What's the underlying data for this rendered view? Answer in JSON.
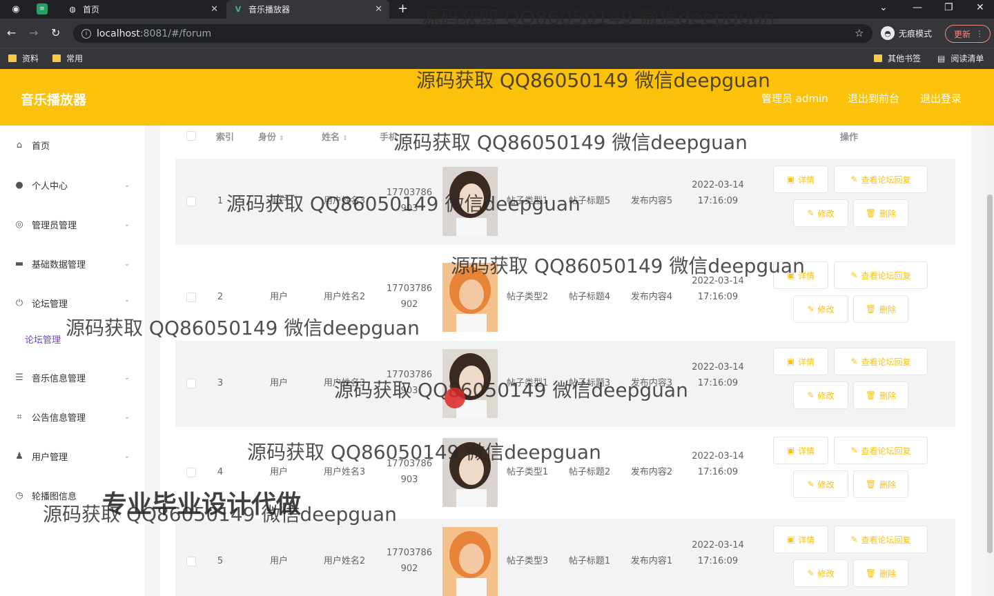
{
  "browser": {
    "tabs": [
      {
        "label": "首页"
      },
      {
        "label": "音乐播放器"
      }
    ],
    "url_host": "localhost",
    "url_path": ":8081/#/forum",
    "incognito_label": "无痕模式",
    "update_label": "更新",
    "bookmarks": [
      {
        "label": "资料"
      },
      {
        "label": "常用"
      }
    ],
    "other_bookmarks_label": "其他书签",
    "reading_list_label": "阅读清单"
  },
  "header": {
    "title": "音乐播放器",
    "admin_label": "管理员 admin",
    "back_front_label": "退出到前台",
    "logout_label": "退出登录"
  },
  "sidebar": {
    "items": [
      {
        "label": "首页",
        "icon": "home-icon"
      },
      {
        "label": "个人中心",
        "icon": "user-icon"
      },
      {
        "label": "管理员管理",
        "icon": "compass-icon"
      },
      {
        "label": "基础数据管理",
        "icon": "monitor-icon"
      },
      {
        "label": "论坛管理",
        "icon": "power-icon"
      },
      {
        "label": "音乐信息管理",
        "icon": "list-icon"
      },
      {
        "label": "公告信息管理",
        "icon": "crop-icon"
      },
      {
        "label": "用户管理",
        "icon": "person-icon"
      },
      {
        "label": "轮播图信息",
        "icon": "clock-icon"
      }
    ],
    "sub_active": "论坛管理"
  },
  "table": {
    "headers": {
      "index": "索引",
      "role": "身份",
      "name": "姓名",
      "phone": "手机",
      "action": "操作"
    },
    "rows": [
      {
        "index": "1",
        "role": "用户",
        "name": "用户姓名3",
        "phone": "17703786 903",
        "type": "帖子类型1",
        "title": "帖子标题5",
        "content": "发布内容5",
        "time": "2022-03-14 17:16:09"
      },
      {
        "index": "2",
        "role": "用户",
        "name": "用户姓名2",
        "phone": "17703786 902",
        "type": "帖子类型2",
        "title": "帖子标题4",
        "content": "发布内容4",
        "time": "2022-03-14 17:16:09"
      },
      {
        "index": "3",
        "role": "用户",
        "name": "用户姓名3",
        "phone": "17703786 903",
        "type": "帖子类型1",
        "title": "帖子标题3",
        "content": "发布内容3",
        "time": "2022-03-14 17:16:09"
      },
      {
        "index": "4",
        "role": "用户",
        "name": "用户姓名3",
        "phone": "17703786 903",
        "type": "帖子类型1",
        "title": "帖子标题2",
        "content": "发布内容2",
        "time": "2022-03-14 17:16:09"
      },
      {
        "index": "5",
        "role": "用户",
        "name": "用户姓名2",
        "phone": "17703786 902",
        "type": "帖子类型3",
        "title": "帖子标题1",
        "content": "发布内容1",
        "time": "2022-03-14 17:16:09"
      }
    ],
    "actions": {
      "detail": "详情",
      "reply": "查看论坛回复",
      "edit": "修改",
      "delete": "删除"
    }
  },
  "watermark": {
    "text": "源码获取 QQ86050149 微信deepguan",
    "ad": "专业毕业设计代做"
  },
  "colors": {
    "brand": "#fcc10a",
    "submenu_active": "#7b3fe4"
  }
}
